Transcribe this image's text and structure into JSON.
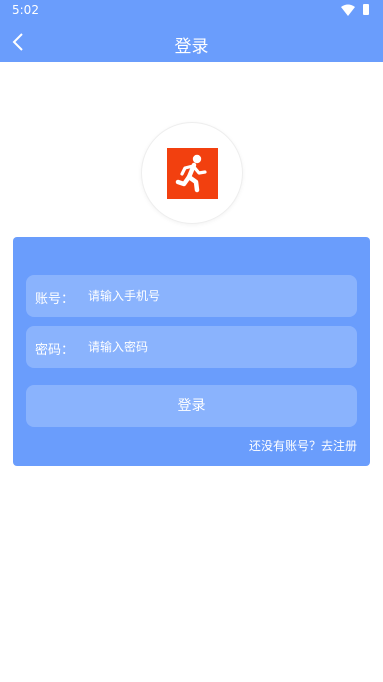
{
  "status_bar": {
    "time": "5:02"
  },
  "header": {
    "title": "登录"
  },
  "form": {
    "account": {
      "label": "账号：",
      "placeholder": "请输入手机号",
      "value": ""
    },
    "password": {
      "label": "密码：",
      "placeholder": "请输入密码",
      "value": ""
    },
    "login_button": "登录",
    "register_link": "还没有账号？去注册"
  },
  "colors": {
    "primary": "#6a9dfc",
    "field_background": "#8ab3fd",
    "logo_red": "#f2400f"
  },
  "icons": {
    "back": "back-arrow-icon",
    "logo": "running-man-icon",
    "wifi": "wifi-icon",
    "battery": "battery-icon"
  }
}
